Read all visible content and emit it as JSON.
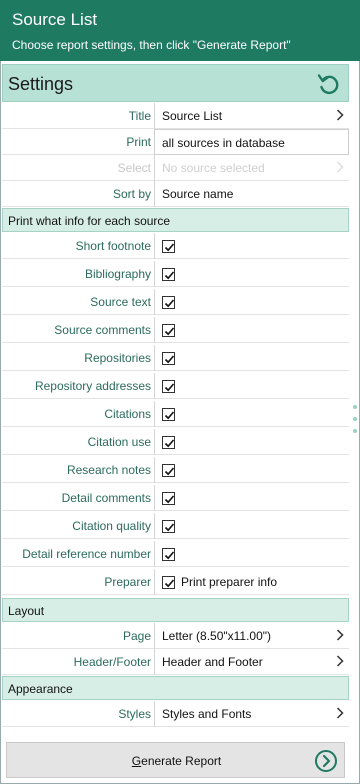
{
  "header": {
    "title": "Source List",
    "subtitle": "Choose report settings, then click \"Generate Report\""
  },
  "settings": {
    "label": "Settings",
    "reset_icon": "reset-icon"
  },
  "fields": {
    "title": {
      "label": "Title",
      "value": "Source List"
    },
    "print": {
      "label": "Print",
      "value": "all sources in database"
    },
    "select": {
      "label": "Select",
      "value": "No source selected"
    },
    "sort_by": {
      "label": "Sort by",
      "value": "Source name"
    }
  },
  "info_section": {
    "heading": "Print what info for each source",
    "options": [
      {
        "label": "Short footnote",
        "checked": true
      },
      {
        "label": "Bibliography",
        "checked": true
      },
      {
        "label": "Source text",
        "checked": true
      },
      {
        "label": "Source comments",
        "checked": true
      },
      {
        "label": "Repositories",
        "checked": true
      },
      {
        "label": "Repository addresses",
        "checked": true
      },
      {
        "label": "Citations",
        "checked": true
      },
      {
        "label": "Citation use",
        "checked": true
      },
      {
        "label": "Research notes",
        "checked": true
      },
      {
        "label": "Detail comments",
        "checked": true
      },
      {
        "label": "Citation quality",
        "checked": true
      },
      {
        "label": "Detail reference number",
        "checked": true
      }
    ],
    "preparer": {
      "label": "Preparer",
      "checkbox_label": "Print preparer info",
      "checked": true
    }
  },
  "layout_section": {
    "heading": "Layout",
    "page": {
      "label": "Page",
      "value": "Letter (8.50\"x11.00\")"
    },
    "header_footer": {
      "label": "Header/Footer",
      "value": "Header and Footer"
    }
  },
  "appearance_section": {
    "heading": "Appearance",
    "styles": {
      "label": "Styles",
      "value": "Styles and Fonts"
    }
  },
  "generate": {
    "label": "Generate Report"
  },
  "colors": {
    "header_bg": "#1f7a62",
    "settings_bar_bg": "#b8e1d5",
    "label_color": "#2b6b5c",
    "section_bg": "#d7eee7"
  }
}
